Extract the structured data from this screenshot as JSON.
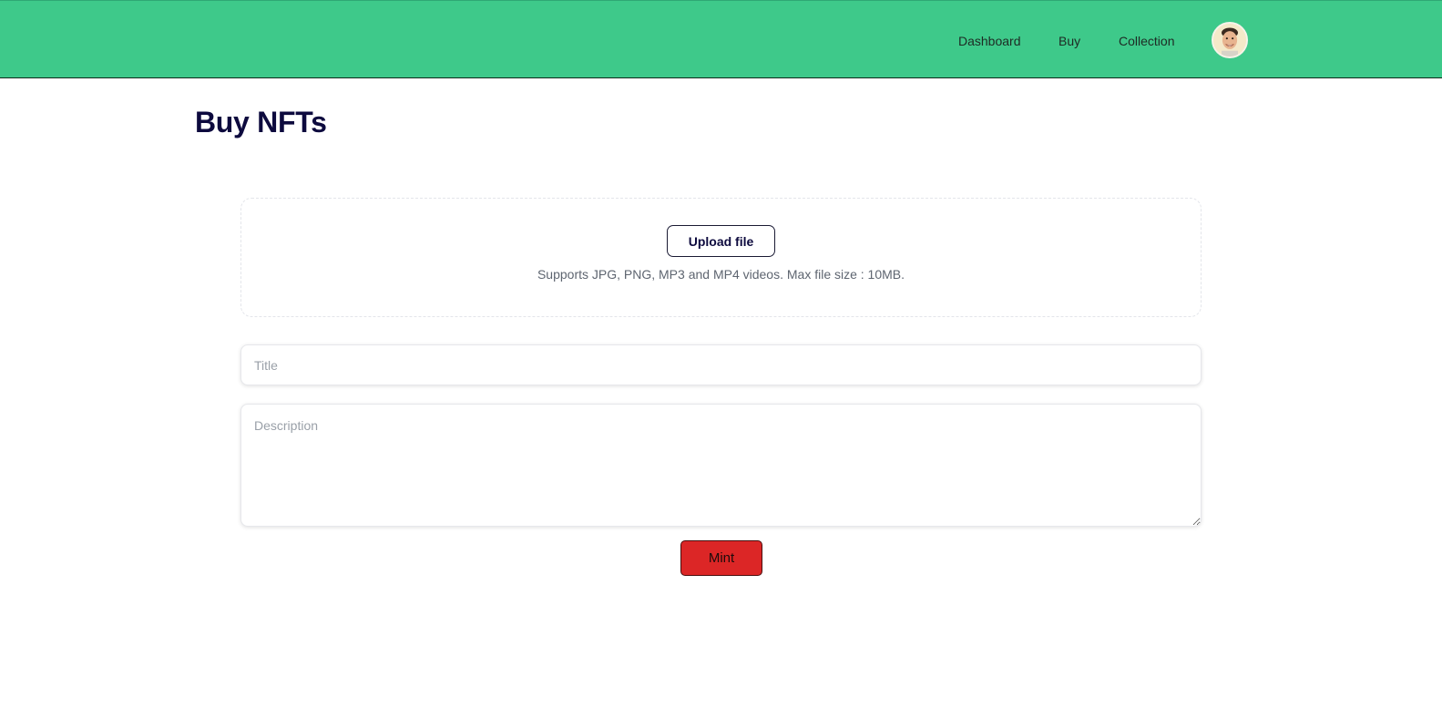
{
  "header": {
    "background_color": "#3ec98a",
    "nav": [
      {
        "label": "Dashboard"
      },
      {
        "label": "Buy"
      },
      {
        "label": "Collection"
      }
    ],
    "avatar_icon": "user-avatar-icon"
  },
  "main": {
    "title": "Buy NFTs",
    "upload": {
      "button_label": "Upload file",
      "hint": "Supports JPG, PNG, MP3 and MP4 videos. Max file size : 10MB."
    },
    "title_field": {
      "placeholder": "Title",
      "value": ""
    },
    "description_field": {
      "placeholder": "Description",
      "value": ""
    },
    "mint_button": {
      "label": "Mint",
      "color": "#dc2626"
    }
  }
}
